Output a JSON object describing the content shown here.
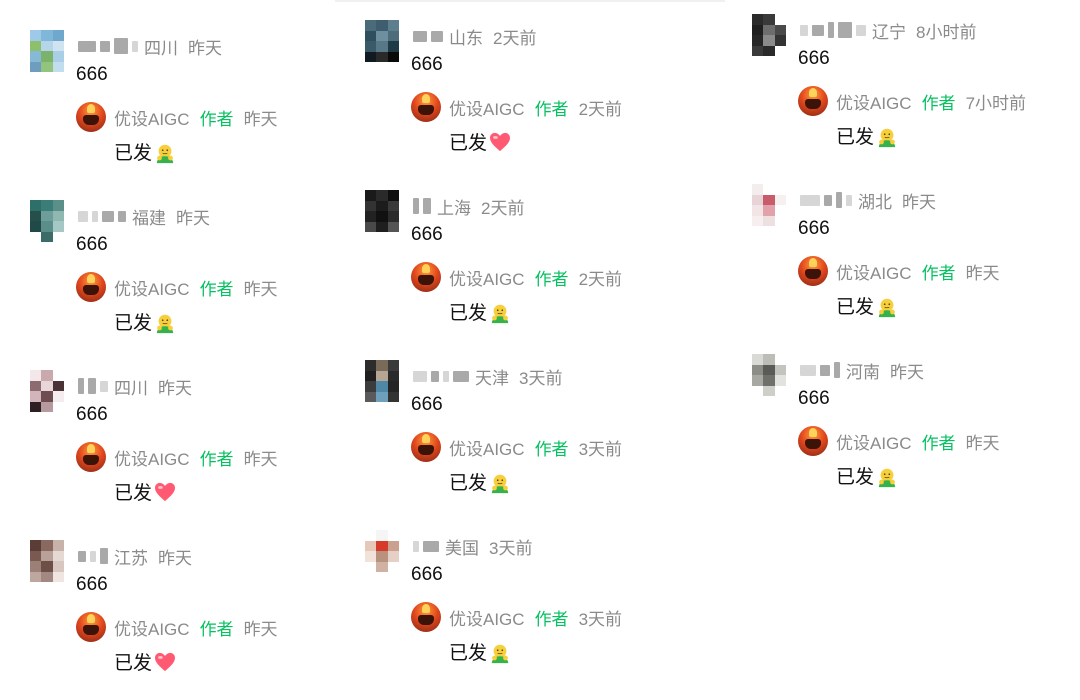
{
  "colors": {
    "author_tag": "#07c160",
    "meta": "#8a8a8a",
    "text": "#111111"
  },
  "columns": [
    [
      {
        "location": "四川",
        "time": "昨天",
        "content": "666",
        "avatar": [
          "#9fc9e8",
          "#7fb7d9",
          "#6fa8cc",
          "#8ec06c",
          "#b6d5ea",
          "#cfe3f1",
          "#86b9d6",
          "#7bb36a",
          "#a8cfe6",
          "#6f9dbf",
          "#93c47d",
          "#c2ddee"
        ],
        "blur": [
          [
            "",
            18
          ],
          [
            "",
            10
          ],
          [
            "tall",
            14
          ],
          [
            "light",
            6
          ]
        ],
        "reply": {
          "author": "优设AIGC",
          "tag": "作者",
          "time": "昨天",
          "text": "已发",
          "emoji": "face-emoji"
        }
      },
      {
        "location": "福建",
        "time": "昨天",
        "content": "666",
        "avatar": [
          "#2f6f6a",
          "#3b7d78",
          "#5a8f8a",
          "#264f4c",
          "#6d9e99",
          "#8fb8b3",
          "#204a47",
          "#5b8e88",
          "#a6c8c4",
          "#ffffff",
          "#3d6c68",
          "#ffffff"
        ],
        "blur": [
          [
            "light",
            10
          ],
          [
            "light",
            6
          ],
          [
            "",
            12
          ],
          [
            "",
            8
          ]
        ],
        "reply": {
          "author": "优设AIGC",
          "tag": "作者",
          "time": "昨天",
          "text": "已发",
          "emoji": "face-emoji"
        }
      },
      {
        "location": "四川",
        "time": "昨天",
        "content": "666",
        "avatar": [
          "#f3e7e9",
          "#c9a8ae",
          "#ffffff",
          "#8c6b71",
          "#e8d6d9",
          "#4a3236",
          "#d1b5ba",
          "#6e4d52",
          "#f4ecee",
          "#2e1f22",
          "#b79aa0",
          "#ffffff"
        ],
        "blur": [
          [
            "tall",
            6
          ],
          [
            "tall",
            8
          ],
          [
            "light",
            8
          ]
        ],
        "reply": {
          "author": "优设AIGC",
          "tag": "作者",
          "time": "昨天",
          "text": "已发",
          "emoji": "heart-emoji"
        }
      },
      {
        "location": "江苏",
        "time": "昨天",
        "content": "666",
        "avatar": [
          "#5a3d36",
          "#8a6a60",
          "#c8b3aa",
          "#7a5a50",
          "#b8a199",
          "#e6d9d4",
          "#9b8078",
          "#6d4f47",
          "#d8c7c1",
          "#bda79f",
          "#a28880",
          "#efe5e1"
        ],
        "blur": [
          [
            "",
            8
          ],
          [
            "light",
            6
          ],
          [
            "tall",
            8
          ]
        ],
        "reply": {
          "author": "优设AIGC",
          "tag": "作者",
          "time": "昨天",
          "text": "已发",
          "emoji": "heart-emoji"
        }
      }
    ],
    [
      {
        "location": "山东",
        "time": "2天前",
        "content": "666",
        "avatar": [
          "#4a6b7a",
          "#3e5e6f",
          "#5c7e8d",
          "#2f4f5e",
          "#6e8f9e",
          "#4d6d7c",
          "#3a5a69",
          "#587887",
          "#1f3a47",
          "#101a20",
          "#2a2a2a",
          "#0a0a0a"
        ],
        "blur": [
          [
            "",
            14
          ],
          [
            "",
            12
          ]
        ],
        "reply": {
          "author": "优设AIGC",
          "tag": "作者",
          "time": "2天前",
          "text": "已发",
          "emoji": "heart-emoji"
        }
      },
      {
        "location": "上海",
        "time": "2天前",
        "content": "666",
        "avatar": [
          "#1a1a1a",
          "#2a2a2a",
          "#0f0f0f",
          "#333333",
          "#1c1c1c",
          "#3a3a3a",
          "#222222",
          "#111111",
          "#2b2b2b",
          "#4a4a4a",
          "#1f1f1f",
          "#555555"
        ],
        "blur": [
          [
            "tall",
            6
          ],
          [
            "tall",
            8
          ]
        ],
        "reply": {
          "author": "优设AIGC",
          "tag": "作者",
          "time": "2天前",
          "text": "已发",
          "emoji": "face-emoji"
        }
      },
      {
        "location": "天津",
        "time": "3天前",
        "content": "666",
        "avatar": [
          "#2c2c2c",
          "#7a6a5a",
          "#3a3a3a",
          "#1f1f1f",
          "#b5a592",
          "#2a2a2a",
          "#3c3c3c",
          "#4f88a6",
          "#242424",
          "#5a5a5a",
          "#6fa0bb",
          "#333333"
        ],
        "blur": [
          [
            "light",
            14
          ],
          [
            "",
            8
          ],
          [
            "light",
            6
          ],
          [
            "",
            16
          ]
        ],
        "reply": {
          "author": "优设AIGC",
          "tag": "作者",
          "time": "3天前",
          "text": "已发",
          "emoji": "face-emoji"
        }
      },
      {
        "location": "美国",
        "time": "3天前",
        "content": "666",
        "avatar": [
          "#ffffff",
          "#f5f5f5",
          "#ffffff",
          "#e7c7b8",
          "#d63a2a",
          "#c9a18e",
          "#f1e2da",
          "#b8927f",
          "#e6d0c5",
          "#ffffff",
          "#cfb2a4",
          "#ffffff"
        ],
        "blur": [
          [
            "light",
            6
          ],
          [
            "",
            16
          ]
        ],
        "reply": {
          "author": "优设AIGC",
          "tag": "作者",
          "time": "3天前",
          "text": "已发",
          "emoji": "face-emoji"
        }
      }
    ],
    [
      {
        "location": "辽宁",
        "time": "8小时前",
        "content": "666",
        "avatar": [
          "#2b2b2b",
          "#3a3a3a",
          "#ffffff",
          "#1f1f1f",
          "#6d6d6d",
          "#4a4a4a",
          "#262626",
          "#8a8a8a",
          "#333333",
          "#3a3a3a",
          "#2a2a2a",
          "#ffffff"
        ],
        "blur": [
          [
            "light",
            8
          ],
          [
            "",
            12
          ],
          [
            "tall",
            6
          ],
          [
            "tall",
            14
          ],
          [
            "light",
            10
          ]
        ],
        "reply": {
          "author": "优设AIGC",
          "tag": "作者",
          "time": "7小时前",
          "text": "已发",
          "emoji": "face-emoji"
        }
      },
      {
        "location": "湖北",
        "time": "昨天",
        "content": "666",
        "avatar": [
          "#f4eded",
          "#ffffff",
          "#ffffff",
          "#e8d4d6",
          "#c95c6a",
          "#f7f0f0",
          "#f1e5e6",
          "#e3a2ab",
          "#ffffff",
          "#f6eeef",
          "#ece0e1",
          "#ffffff"
        ],
        "blur": [
          [
            "light",
            20
          ],
          [
            "",
            8
          ],
          [
            "tall",
            6
          ],
          [
            "light",
            6
          ]
        ],
        "reply": {
          "author": "优设AIGC",
          "tag": "作者",
          "time": "昨天",
          "text": "已发",
          "emoji": "face-emoji"
        }
      },
      {
        "location": "河南",
        "time": "昨天",
        "content": "666",
        "avatar": [
          "#d9d9d6",
          "#bdbdb8",
          "#ffffff",
          "#8d8d88",
          "#5a5a56",
          "#c4c4bf",
          "#a8a8a3",
          "#70706b",
          "#e2e2de",
          "#ffffff",
          "#cfcfca",
          "#ffffff"
        ],
        "blur": [
          [
            "light",
            16
          ],
          [
            "",
            10
          ],
          [
            "tall",
            6
          ]
        ],
        "reply": {
          "author": "优设AIGC",
          "tag": "作者",
          "time": "昨天",
          "text": "已发",
          "emoji": "face-emoji"
        }
      }
    ]
  ]
}
